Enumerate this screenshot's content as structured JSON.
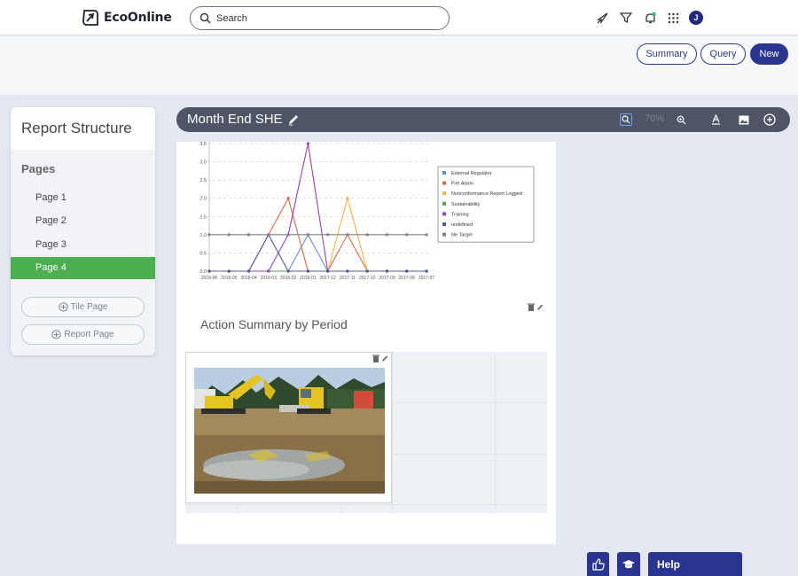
{
  "header": {
    "brand": "EcoOnline",
    "search_placeholder": "Search",
    "avatar_initial": "J"
  },
  "actions": {
    "summary": "Summary",
    "query": "Query",
    "new": "New"
  },
  "left_panel": {
    "title": "Report Structure",
    "pages_heading": "Pages",
    "pages": [
      "Page 1",
      "Page 2",
      "Page 3",
      "Page 4"
    ],
    "active_page": "Page 4",
    "tile_page_btn": "Tile Page",
    "report_page_btn": "Report Page"
  },
  "report": {
    "title": "Month End SHE",
    "zoom": "70%",
    "section_title": "Action Summary by Period"
  },
  "chart_data": {
    "type": "line",
    "categories": [
      "2018-06",
      "2018-05",
      "2018-04",
      "2018-03",
      "2018-02",
      "2018-01",
      "2017-12",
      "2017-11",
      "2017-10",
      "2017-09",
      "2017-08",
      "2017-07"
    ],
    "ylim": [
      0,
      3.5
    ],
    "yticks": [
      "0.0",
      "0.5",
      "1.0",
      "1.5",
      "2.0",
      "2.5",
      "3.0",
      "3.5"
    ],
    "grid": true,
    "legend_position": "top-right",
    "series": [
      {
        "name": "External Regulator",
        "color": "#5b8fd1",
        "values": [
          0,
          0,
          0,
          0,
          0,
          1,
          0,
          0,
          0,
          0,
          0,
          0
        ]
      },
      {
        "name": "Fire Alarm",
        "color": "#e0683f",
        "values": [
          0,
          0,
          0,
          1,
          2,
          0,
          0,
          1,
          0,
          0,
          0,
          0
        ]
      },
      {
        "name": "Nonconformance Report Logged",
        "color": "#f5b342",
        "values": [
          0,
          0,
          0,
          0,
          0,
          0,
          0,
          2,
          0,
          0,
          0,
          0
        ]
      },
      {
        "name": "Sustainability",
        "color": "#45a84a",
        "values": [
          0,
          0,
          0,
          0,
          0,
          0,
          0,
          0,
          0,
          0,
          0,
          0
        ]
      },
      {
        "name": "Training",
        "color": "#9b3fb5",
        "values": [
          0,
          0,
          0,
          0,
          1,
          4,
          0,
          0,
          0,
          0,
          0,
          0
        ]
      },
      {
        "name": "undefined",
        "color": "#4a5ba8",
        "values": [
          0,
          0,
          0,
          1,
          0,
          0,
          0,
          0,
          0,
          0,
          0,
          0
        ]
      },
      {
        "name": "tile Target",
        "color": "#808080",
        "values": [
          1,
          1,
          1,
          1,
          1,
          1,
          1,
          1,
          1,
          1,
          1,
          1
        ]
      }
    ]
  },
  "widgets": {
    "help": "Help"
  }
}
